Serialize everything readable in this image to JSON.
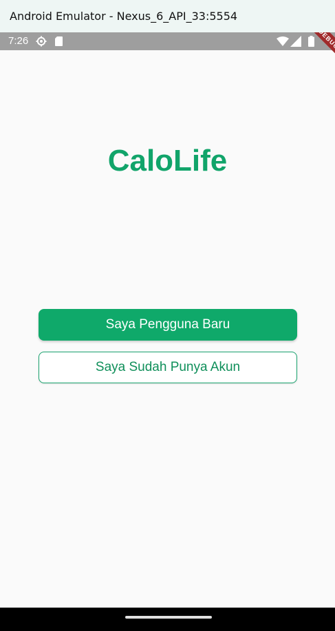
{
  "window": {
    "title": "Android Emulator - Nexus_6_API_33:5554"
  },
  "status_bar": {
    "time": "7:26",
    "icons": [
      "gear-icon",
      "sim-card-icon",
      "wifi-icon",
      "signal-icon",
      "battery-icon"
    ],
    "background": "#9e9e9e"
  },
  "debug_banner": {
    "label": "DEBUG",
    "color": "#a02b2b"
  },
  "app": {
    "title": "CaloLife",
    "brand_color": "#11a46a"
  },
  "buttons": {
    "new_user": "Saya Pengguna Baru",
    "have_account": "Saya Sudah Punya Akun"
  }
}
